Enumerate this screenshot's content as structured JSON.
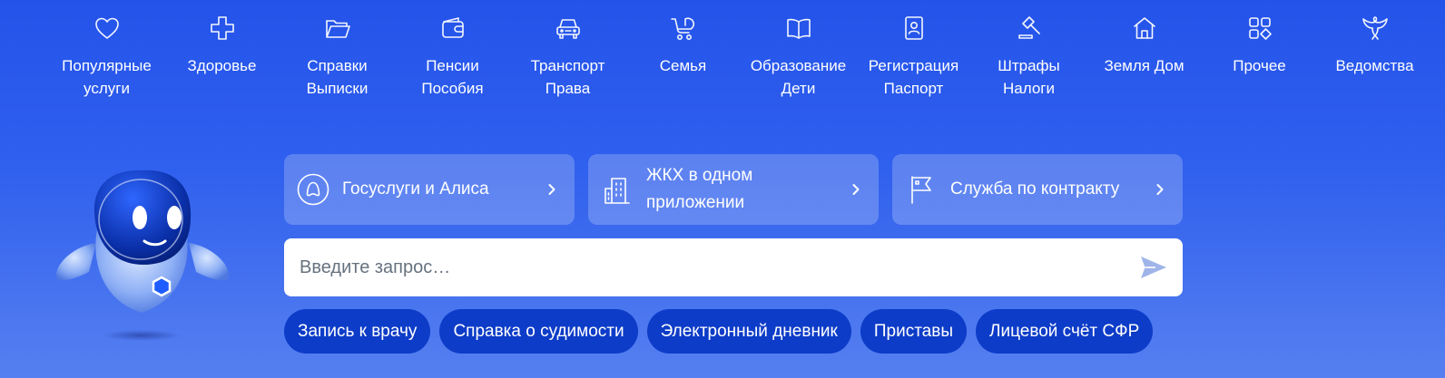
{
  "categories": [
    {
      "label": "Популярные\nуслуги",
      "icon": "heart-icon"
    },
    {
      "label": "Здоровье",
      "icon": "medical-cross-icon"
    },
    {
      "label": "Справки\nВыписки",
      "icon": "folder-icon"
    },
    {
      "label": "Пенсии\nПособия",
      "icon": "wallet-icon"
    },
    {
      "label": "Транспорт\nПрава",
      "icon": "car-icon"
    },
    {
      "label": "Семья",
      "icon": "stroller-icon"
    },
    {
      "label": "Образование\nДети",
      "icon": "book-icon"
    },
    {
      "label": "Регистрация\nПаспорт",
      "icon": "passport-icon"
    },
    {
      "label": "Штрафы\nНалоги",
      "icon": "gavel-icon"
    },
    {
      "label": "Земля Дом",
      "icon": "house-icon"
    },
    {
      "label": "Прочее",
      "icon": "grid-icon"
    },
    {
      "label": "Ведомства",
      "icon": "eagle-icon"
    }
  ],
  "promos": [
    {
      "label": "Госуслуги и Алиса",
      "icon": "alice-icon"
    },
    {
      "label": "ЖКХ в одном\nприложении",
      "icon": "building-icon"
    },
    {
      "label": "Служба по контракту",
      "icon": "flag-icon"
    }
  ],
  "search": {
    "placeholder": "Введите запрос…",
    "value": ""
  },
  "quick_links": [
    "Запись к врачу",
    "Справка о судимости",
    "Электронный дневник",
    "Приставы",
    "Лицевой счёт СФР"
  ],
  "colors": {
    "background": "#2453ea",
    "chip": "#0d3cc8",
    "card": "rgba(255,255,255,0.22)",
    "search_send": "#9fb4e8"
  }
}
